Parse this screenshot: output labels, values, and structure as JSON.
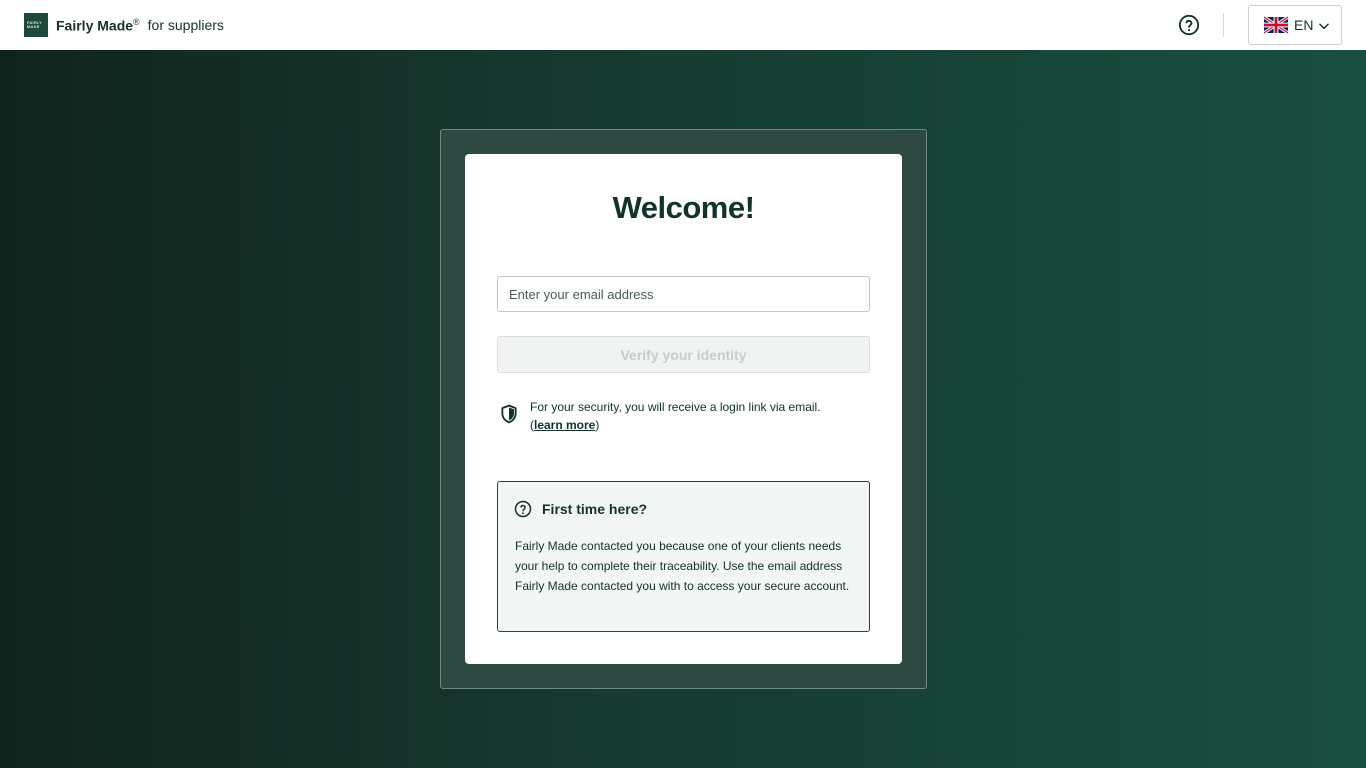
{
  "header": {
    "brand_name": "Fairly Made",
    "brand_mark": "®",
    "brand_subtitle": "for suppliers",
    "logo_lines": [
      "FAIRLY",
      "MADE"
    ],
    "help_icon": "help-circle-icon",
    "language": {
      "code": "EN",
      "flag_icon": "uk-flag-icon"
    }
  },
  "login": {
    "title": "Welcome!",
    "email_placeholder": "Enter your email address",
    "email_value": "",
    "verify_label": "Verify your identity",
    "security_text": "For your security, you will receive a login link via email.",
    "learn_more_open": "(",
    "learn_more_label": "learn more",
    "learn_more_close": ")"
  },
  "first_time": {
    "title": "First time here?",
    "body": "Fairly Made contacted you because one of your clients needs your help to complete their traceability. Use the email address Fairly Made contacted you with to access your secure account."
  },
  "colors": {
    "brand_dark": "#12332a",
    "brand_green": "#1f4a3b",
    "background_start": "#10241d",
    "background_end": "#194e40"
  }
}
